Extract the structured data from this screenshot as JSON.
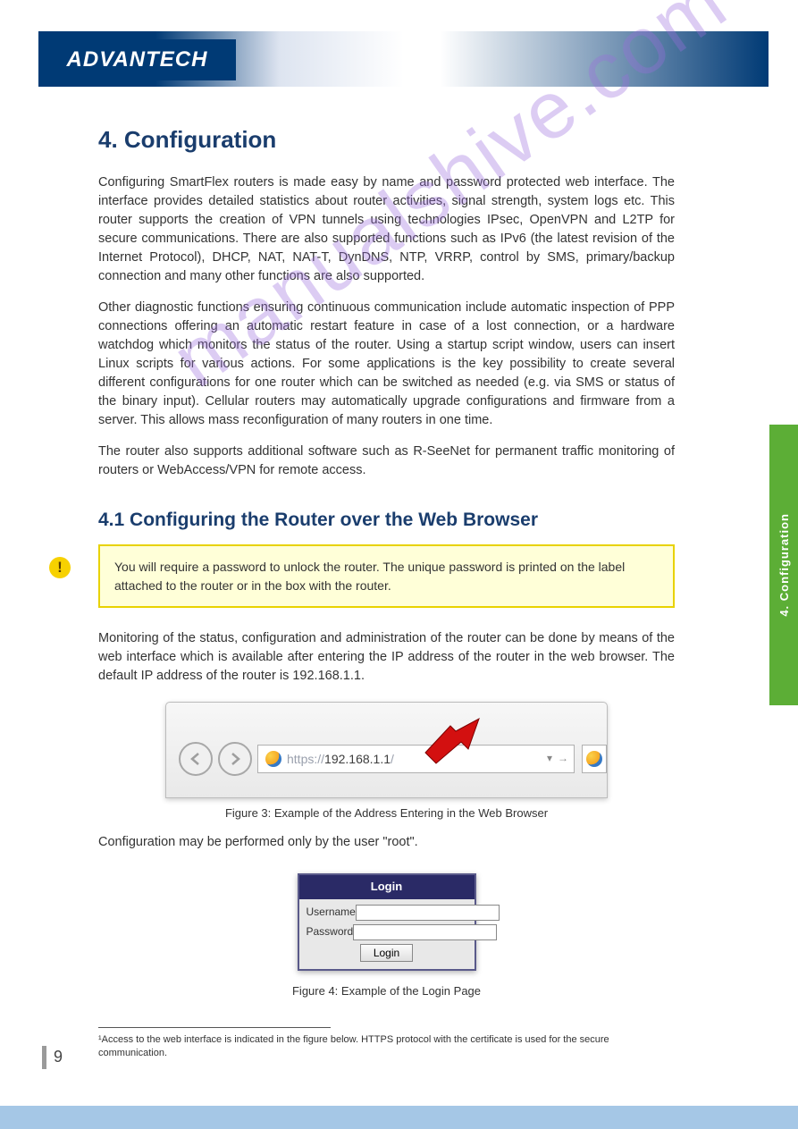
{
  "brand": {
    "logo_text": "ADVANTECH"
  },
  "side_tab": {
    "label": "4. Configuration"
  },
  "page": {
    "number": "9",
    "h1": "4. Configuration",
    "intro_para": "Configuring SmartFlex routers is made easy by name and password protected web interface. The interface provides detailed statistics about router activities, signal strength, system logs etc. This router supports the creation of VPN tunnels using technologies IPsec, OpenVPN and L2TP for secure communications. There are also supported functions such as IPv6 (the latest revision of the Internet Protocol), DHCP, NAT, NAT-T, DynDNS, NTP, VRRP, control by SMS, primary/backup connection and many other functions are also supported.",
    "features_para": "Other diagnostic functions ensuring continuous communication include automatic inspection of PPP connections offering an automatic restart feature in case of a lost connection, or a hardware watchdog which monitors the status of the router. Using a startup script window, users can insert Linux scripts for various actions. For some applications is the key possibility to create several different configurations for one router which can be switched as needed (e.g. via SMS or status of the binary input). Cellular routers may automatically upgrade configurations and firmware from a server. This allows mass reconfiguration of many routers in one time.",
    "modules_para": "The router also supports additional software such as R-SeeNet for permanent traffic monitoring of routers or WebAccess/VPN for remote access.",
    "h2": "4.1 Configuring the Router over the Web Browser",
    "caution": "You will require a password to unlock the router. The unique password is printed on the label attached to the router or in the box with the router.",
    "monitoring_para": "Monitoring of the status, configuration and administration of the router can be done by means of the web interface which is available after entering the IP address of the router in the web browser. The default IP address of the router is 192.168.1.1.",
    "fig1_caption": "Figure 3: Example of the Address Entering in the Web Browser",
    "login_para": "Configuration may be performed only by the user \"root\".",
    "fig2_caption": "Figure 4: Example of the Login Page",
    "footnote": "¹Access to the web interface is indicated in the figure below. HTTPS protocol with the certificate is used for the secure communication.",
    "browser": {
      "url_prefix": "https://",
      "url_ip": "192.168.1.1",
      "url_suffix": "/"
    },
    "login_box": {
      "title": "Login",
      "username_label": "Username",
      "password_label": "Password",
      "username_value": "",
      "password_value": "",
      "button_label": "Login"
    }
  }
}
